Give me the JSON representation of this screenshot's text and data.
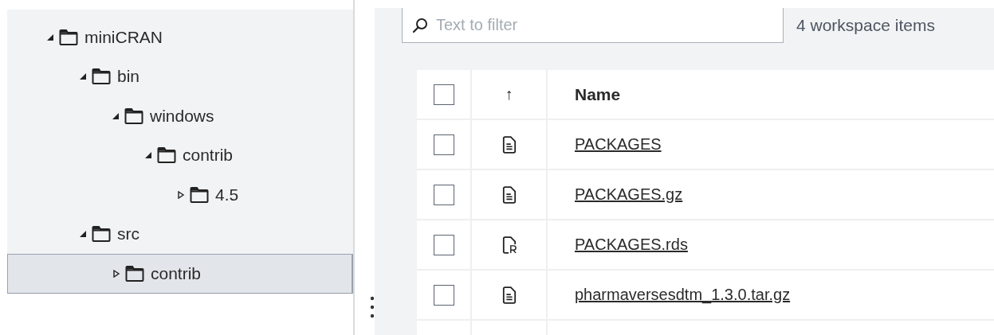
{
  "tree": [
    {
      "label": "miniCRAN",
      "expanded": true,
      "selected": false,
      "children": [
        {
          "label": "bin",
          "expanded": true,
          "selected": false,
          "children": [
            {
              "label": "windows",
              "expanded": true,
              "selected": false,
              "children": [
                {
                  "label": "contrib",
                  "expanded": true,
                  "selected": false,
                  "children": [
                    {
                      "label": "4.5",
                      "expanded": false,
                      "selected": false
                    }
                  ]
                }
              ]
            }
          ]
        },
        {
          "label": "src",
          "expanded": true,
          "selected": false,
          "children": [
            {
              "label": "contrib",
              "expanded": false,
              "selected": true
            }
          ]
        }
      ]
    }
  ],
  "filter": {
    "placeholder": "Text to filter"
  },
  "item_count": "4 workspace items",
  "table": {
    "sort_indicator": "↑",
    "columns": [
      "Name"
    ],
    "all_checked": false,
    "rows": [
      {
        "name": "PACKAGES",
        "kind": "text",
        "checked": false
      },
      {
        "name": "PACKAGES.gz",
        "kind": "text",
        "checked": false
      },
      {
        "name": "PACKAGES.rds",
        "kind": "r",
        "checked": false
      },
      {
        "name": "pharmaversesdtm_1.3.0.tar.gz",
        "kind": "text",
        "checked": false
      }
    ]
  }
}
